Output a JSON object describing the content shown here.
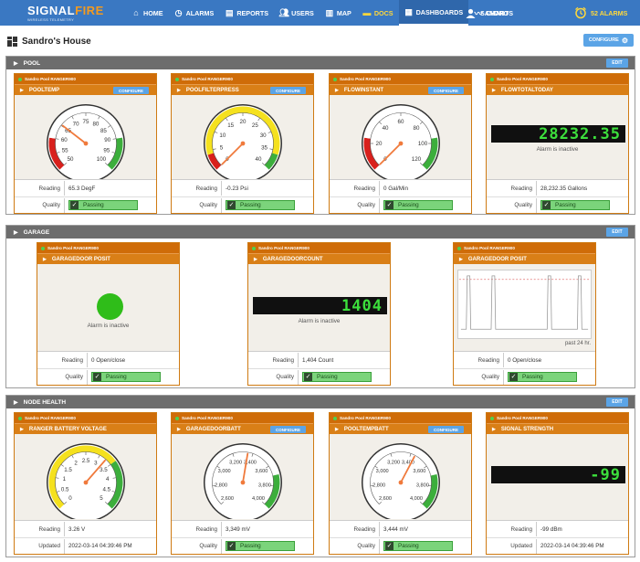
{
  "brand": {
    "name_a": "SIGNAL",
    "name_b": "FIRE",
    "tagline": "WIRELESS TELEMETRY"
  },
  "nav": [
    {
      "label": "HOME",
      "icon": "home-icon"
    },
    {
      "label": "ALARMS",
      "icon": "alarm-clock-icon"
    },
    {
      "label": "REPORTS",
      "icon": "reports-icon"
    },
    {
      "label": "USERS",
      "icon": "users-icon"
    },
    {
      "label": "MAP",
      "icon": "map-icon"
    },
    {
      "label": "DOCS",
      "icon": "docs-icon"
    },
    {
      "label": "DASHBOARDS",
      "icon": "dashboard-icon"
    },
    {
      "label": "CHARTS",
      "icon": "chart-icon"
    }
  ],
  "user": {
    "name": "SANDRO"
  },
  "alarms": {
    "label": "52 ALARMS"
  },
  "page": {
    "title": "Sandro's House",
    "configure": "CONFIGURE"
  },
  "sections": {
    "pool": {
      "title": "POOL",
      "edit": "EDIT"
    },
    "garage": {
      "title": "GARAGE",
      "edit": "EDIT"
    },
    "node": {
      "title": "NODE HEALTH",
      "edit": "EDIT"
    }
  },
  "common": {
    "device": "Sandro Pool RANGER900",
    "configure": "CONFIGURE",
    "reading": "Reading",
    "quality": "Quality",
    "updated": "Updated",
    "passing": "Passing",
    "alarm_inactive": "Alarm is inactive"
  },
  "pool": [
    {
      "title": "POOLTEMP",
      "reading": "65.3 DegF",
      "gauge_value": 65.3,
      "ticks": [
        "50",
        "55",
        "60",
        "65",
        "70",
        "75",
        "80",
        "85",
        "90",
        "95",
        "100"
      ]
    },
    {
      "title": "POOLFILTERPRESS",
      "reading": "-0.23 Psi",
      "gauge_value": -0.23,
      "ticks": [
        "0",
        "5",
        "10",
        "15",
        "20",
        "25",
        "30",
        "35",
        "40"
      ]
    },
    {
      "title": "FLOWINSTANT",
      "reading": "0 Gal/Min",
      "gauge_value": 0,
      "ticks": [
        "0",
        "20",
        "40",
        "60",
        "80",
        "100",
        "120"
      ]
    },
    {
      "title": "FLOWTOTALTODAY",
      "reading": "28,232.35 Gallons",
      "lcd": "28232.35"
    }
  ],
  "garage": [
    {
      "title": "GARAGEDOOR POSIT",
      "reading": "0 Open/close",
      "indicator": "green"
    },
    {
      "title": "GARAGEDOORCOUNT",
      "reading": "1,404 Count",
      "lcd": "1404"
    },
    {
      "title": "GARAGEDOOR POSIT",
      "reading": "0 Open/close",
      "chart_caption": "past 24 hr."
    }
  ],
  "node": [
    {
      "title": "RANGER BATTERY VOLTAGE",
      "reading": "3.26 V",
      "updated": "2022-03-14 04:39:46 PM",
      "gauge_value": 3.26,
      "ticks": [
        "0",
        "0.5",
        "1",
        "1.5",
        "2",
        "2.5",
        "3",
        "3.5",
        "4",
        "4.5",
        "5"
      ]
    },
    {
      "title": "GARAGEDOORBATT",
      "reading": "3,349 mV",
      "gauge_value": 3349,
      "ticks": [
        "2,600",
        "2,800",
        "3,000",
        "3,200",
        "3,400",
        "3,600",
        "3,800",
        "4,000"
      ]
    },
    {
      "title": "POOLTEMPBATT",
      "reading": "3,444 mV",
      "gauge_value": 3444,
      "ticks": [
        "2,600",
        "2,800",
        "3,000",
        "3,200",
        "3,400",
        "3,600",
        "3,800",
        "4,000"
      ]
    },
    {
      "title": "SIGNAL STRENGTH",
      "reading": "-99 dBm",
      "updated": "2022-03-14 04:39:46 PM",
      "lcd": "-99"
    }
  ]
}
